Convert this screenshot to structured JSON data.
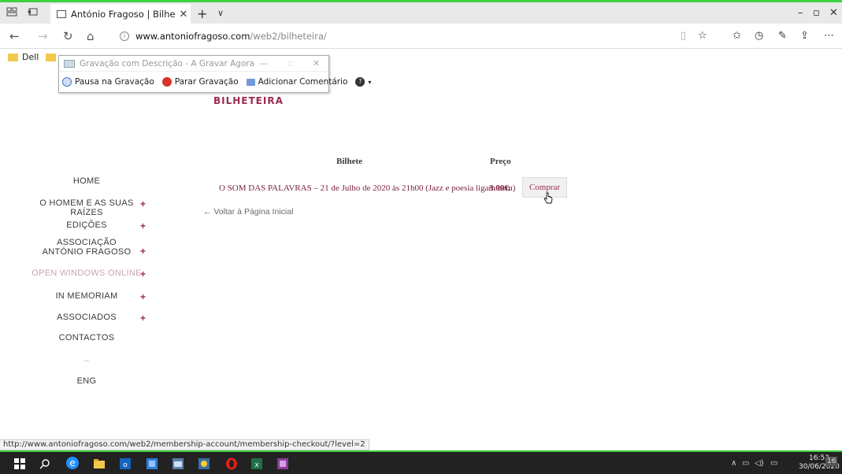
{
  "browser": {
    "tab_title": "António Fragoso | Bilhe",
    "address_host": "www.antoniofragoso.com",
    "address_path": "/web2/bilheteira/",
    "favorites": [
      {
        "label": "Dell"
      }
    ],
    "status_url": "http://www.antoniofragoso.com/web2/membership-account/membership-checkout/?level=2"
  },
  "recorder": {
    "title": "Gravação com Descrição - A Gravar Agora",
    "pause_label": "Pausa na Gravação",
    "stop_label": "Parar Gravação",
    "comment_label": "Adicionar Comentário",
    "help_label": "?"
  },
  "page": {
    "heading": "BILHETEIRA",
    "menu": [
      {
        "label": "HOME",
        "plus": ""
      },
      {
        "label": "O HOMEM E AS SUAS RAÍZES",
        "plus": "+"
      },
      {
        "label": "EDIÇÕES",
        "plus": "+"
      },
      {
        "label": "ASSOCIAÇÃO ANTÓNIO FRAGOSO",
        "plus": "+"
      },
      {
        "label": "OPEN WINDOWS ONLINE",
        "plus": "+"
      },
      {
        "label": "IN MEMORIAM",
        "plus": "+"
      },
      {
        "label": "ASSOCIADOS",
        "plus": "+"
      },
      {
        "label": "CONTACTOS",
        "plus": ""
      },
      {
        "label": "–",
        "plus": ""
      },
      {
        "label": "ENG",
        "plus": ""
      }
    ],
    "table": {
      "headers": {
        "ticket": "Bilhete",
        "price": "Preço"
      },
      "rows": [
        {
          "ticket": "O SOM DAS PALAVRAS – 21 de Julho de 2020 às 21h00 (Jazz e poesia ligam bem)",
          "price": "3.00€.",
          "action": "Comprar"
        }
      ]
    },
    "back_link": "← Voltar à Página Inicial"
  },
  "taskbar": {
    "time": "16:53",
    "date": "30/06/2020",
    "notification_count": "16"
  },
  "colors": {
    "accent": "#9b2a4e",
    "recording_border": "#3fd23f"
  }
}
